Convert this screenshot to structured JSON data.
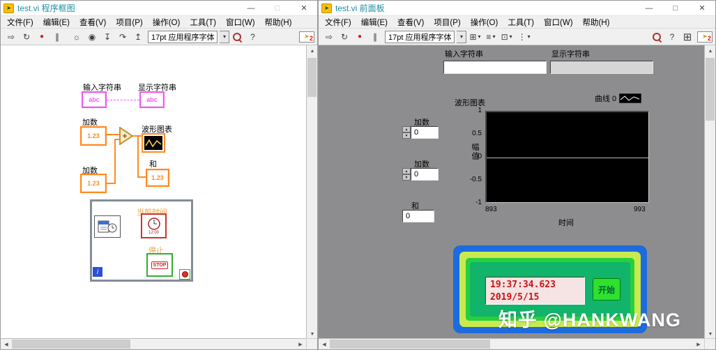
{
  "menubar": {
    "items": [
      "文件(F)",
      "编辑(E)",
      "查看(V)",
      "项目(P)",
      "操作(O)",
      "工具(T)",
      "窗口(W)",
      "帮助(H)"
    ]
  },
  "toolbar": {
    "font_selector": "17pt 应用程序字体",
    "badge_count": "2"
  },
  "icons": {
    "dropdown": "▾",
    "minimize": "—",
    "maximize": "□",
    "close": "✕",
    "run": "⇨",
    "run_continuous": "↻",
    "abort": "●",
    "pause": "∥",
    "highlight": "☼",
    "retain": "◉",
    "step_into": "↧",
    "step_over": "↷",
    "step_out": "↥",
    "align": "⊞",
    "distribute": "≡",
    "resize": "⊡",
    "reorder": "⋮",
    "grid": "⊞",
    "help": "?",
    "logo_arrow": "➤",
    "scroll_up": "▲",
    "scroll_down": "▼",
    "scroll_left": "◀",
    "scroll_right": "▶",
    "spin_up": "▲",
    "spin_down": "▼"
  },
  "block_diagram": {
    "window_title": "test.vi 程序框图",
    "labels": {
      "input_string": "输入字符串",
      "display_string": "显示字符串",
      "addend1": "加数",
      "addend2": "加数",
      "waveform_chart": "波形图表",
      "sum": "和",
      "current_time": "当前时间",
      "stop": "停止"
    },
    "terminals": {
      "string_value": "abc",
      "numeric_value": "1.23",
      "stop_button": "STOP",
      "iteration": "i",
      "clock_face": "12:00"
    }
  },
  "front_panel": {
    "window_title": "test.vi 前面板",
    "input_string_label": "输入字符串",
    "input_string_value": "",
    "display_string_label": "显示字符串",
    "display_string_value": "",
    "addend1_label": "加数",
    "addend1_value": "0",
    "addend2_label": "加数",
    "addend2_value": "0",
    "sum_label": "和",
    "sum_value": "0",
    "clock_time": "19:37:34.623",
    "clock_date": "2019/5/15",
    "start_button": "开始",
    "watermark": "知乎 @HANKWANG"
  },
  "chart_data": {
    "type": "line",
    "title": "波形图表",
    "xlabel": "时间",
    "ylabel": "幅值",
    "xlim": [
      893,
      993
    ],
    "ylim": [
      -1,
      1
    ],
    "x_ticks": [
      "893",
      "993"
    ],
    "y_ticks": [
      "1",
      "0.5",
      "0",
      "-0.5",
      "-1"
    ],
    "legend": [
      "曲线 0"
    ],
    "legend_position": "top-right",
    "series": [
      {
        "name": "曲线 0",
        "values": []
      }
    ],
    "plot_background": "#000000",
    "grid": "horizontal zero-line only"
  },
  "colors": {
    "titlebar_text": "#1f8fa6",
    "string_pink": "#f056f0",
    "numeric_orange": "#ff8a21",
    "loop_border_gray": "#848c98",
    "stop_green": "#2faf2f",
    "clock_red": "#cc1111",
    "frame_blue": "#1d6bdc",
    "frame_lime": "#c9e94f",
    "frame_green": "#27cf3f",
    "frame_inner_green": "#12b36a",
    "start_button_green": "#2ee12e",
    "panel_gray": "#8d8d90"
  }
}
